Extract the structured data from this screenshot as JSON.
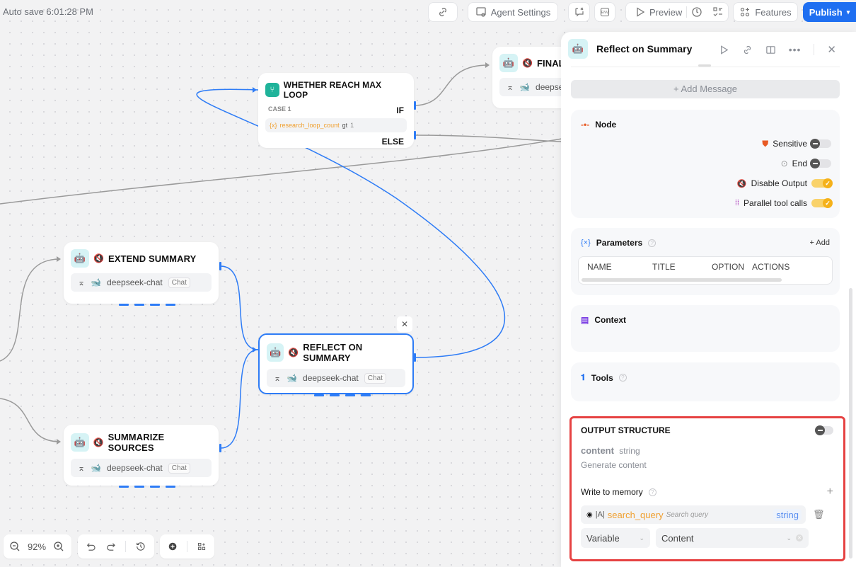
{
  "topbar": {
    "autosave": "Auto save 6:01:28 PM",
    "agent_settings": "Agent Settings",
    "preview": "Preview",
    "features": "Features",
    "publish": "Publish"
  },
  "nodes": {
    "condition": {
      "title": "WHETHER REACH MAX LOOP",
      "case": "CASE 1",
      "if": "IF",
      "else": "ELSE",
      "var_icon": "{x}",
      "variable": "research_loop_count",
      "op": "gt",
      "value": "1"
    },
    "final": {
      "title": "FINAL",
      "model": "deepse"
    },
    "extend": {
      "title": "EXTEND SUMMARY",
      "model": "deepseek-chat",
      "chip": "Chat"
    },
    "reflect": {
      "title": "REFLECT ON SUMMARY",
      "model": "deepseek-chat",
      "chip": "Chat"
    },
    "summarize": {
      "title": "SUMMARIZE SOURCES",
      "model": "deepseek-chat",
      "chip": "Chat"
    }
  },
  "zoom": {
    "level": "92%"
  },
  "panel": {
    "title": "Reflect on Summary",
    "add_message": "+ Add Message",
    "node_section": {
      "title": "Node",
      "toggles": [
        {
          "label": "Sensitive",
          "on": false
        },
        {
          "label": "End",
          "on": false
        },
        {
          "label": "Disable Output",
          "on": true
        },
        {
          "label": "Parallel tool calls",
          "on": true
        }
      ]
    },
    "parameters": {
      "title": "Parameters",
      "add": "+ Add",
      "columns": [
        "NAME",
        "TITLE",
        "OPTION",
        "ACTIONS"
      ]
    },
    "context": {
      "title": "Context"
    },
    "tools": {
      "title": "Tools"
    },
    "output": {
      "title": "OUTPUT STRUCTURE",
      "enabled": false,
      "field_name": "content",
      "field_type": "string",
      "field_desc": "Generate content",
      "write_memory": "Write to memory",
      "mem_icon_text": "|A|",
      "mem_var": "search_query",
      "mem_desc": "Search query",
      "mem_type": "string",
      "source_select": "Variable",
      "value_select": "Content"
    }
  },
  "colors": {
    "accent": "#1f6ff1",
    "edge": "#2e7cf6",
    "toggle_on": "#f5b11a",
    "highlight": "#e64242",
    "orange_var": "#f0a030"
  }
}
